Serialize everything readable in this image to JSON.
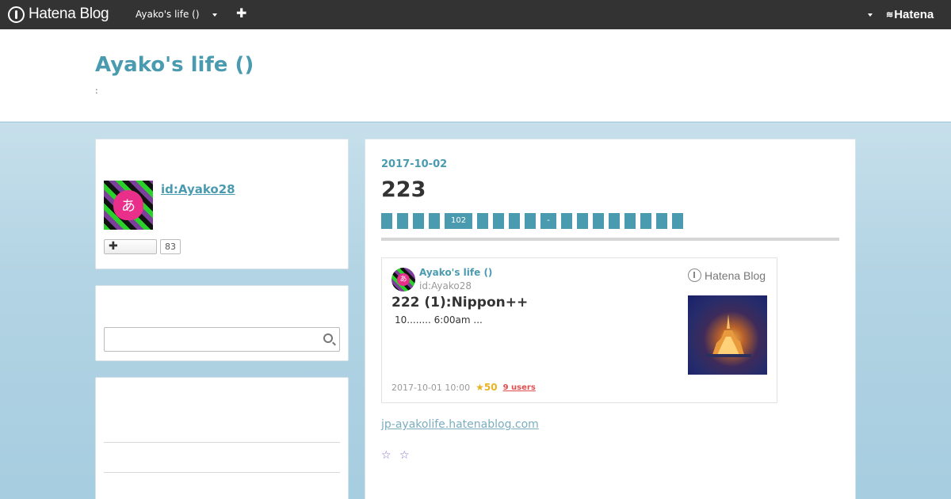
{
  "global_header": {
    "logo_text": "Hatena Blog",
    "blog_selector": "Ayako's life ()",
    "add_label": "✚",
    "hatena_label": "Hatena"
  },
  "blog": {
    "title": "Ayako's life ()",
    "description": ":"
  },
  "sidebar": {
    "profile": {
      "id_label": "id:Ayako28",
      "avatar_char": "あ",
      "follow_label": "✚",
      "follow_count": "83"
    },
    "search": {
      "placeholder": ""
    }
  },
  "entry": {
    "date": "2017-10-02",
    "title": "223",
    "categories": [
      "",
      "",
      "",
      "",
      "102",
      "",
      "",
      "",
      "",
      "-",
      "",
      "",
      "",
      "",
      "",
      "",
      "",
      ""
    ],
    "embed": {
      "blog_name": "Ayako's life ()",
      "user_id": "id:Ayako28",
      "avatar_char": "あ",
      "title": "222 (1):Nippon++",
      "excerpt": "10........  6:00am ...",
      "brand": "Hatena Blog",
      "timestamp": "2017-10-01 10:00",
      "stars": "★50",
      "bookmarks": "9 users"
    },
    "link_text": "jp-ayakolife.hatenablog.com",
    "star_marks": "☆ ☆"
  },
  "colors": {
    "header_bg": "#333333",
    "accent": "#4a9bb0",
    "star": "#e6b422",
    "bookmark": "#e24d4d"
  }
}
